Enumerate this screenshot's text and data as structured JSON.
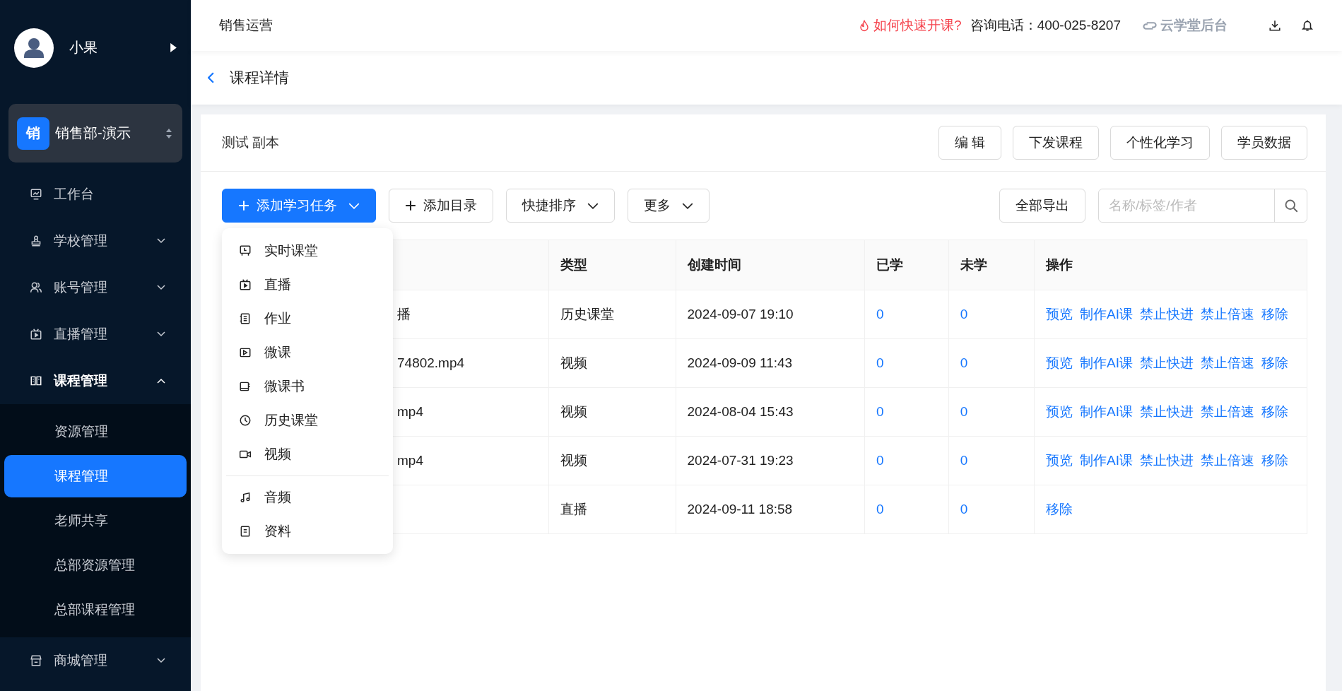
{
  "sidebar": {
    "user": {
      "name": "小果"
    },
    "org": {
      "badge": "销",
      "name": "销售部-演示"
    },
    "items": [
      {
        "label": "工作台",
        "kind": "link"
      },
      {
        "label": "学校管理",
        "kind": "group",
        "expanded": false
      },
      {
        "label": "账号管理",
        "kind": "group",
        "expanded": false
      },
      {
        "label": "直播管理",
        "kind": "group",
        "expanded": false
      },
      {
        "label": "课程管理",
        "kind": "group",
        "expanded": true,
        "children": [
          {
            "label": "资源管理",
            "selected": false
          },
          {
            "label": "课程管理",
            "selected": true
          },
          {
            "label": "老师共享",
            "selected": false
          },
          {
            "label": "总部资源管理",
            "selected": false
          },
          {
            "label": "总部课程管理",
            "selected": false
          }
        ]
      },
      {
        "label": "商城管理",
        "kind": "group",
        "expanded": false
      }
    ]
  },
  "header": {
    "title": "销售运营",
    "help_link": "如何快速开课?",
    "phone": "咨询电话：400-025-8207",
    "brand": "云学堂后台"
  },
  "breadcrumb": {
    "title": "课程详情"
  },
  "course": {
    "title": "测试 副本",
    "actions": [
      "编 辑",
      "下发课程",
      "个性化学习",
      "学员数据"
    ]
  },
  "toolbar": {
    "add_task": "添加学习任务",
    "add_folder": "添加目录",
    "sort": "快捷排序",
    "more": "更多",
    "export": "全部导出",
    "search": {
      "placeholder": "名称/标签/作者"
    }
  },
  "task_menu": {
    "groups": [
      [
        {
          "label": "实时课堂"
        },
        {
          "label": "直播"
        },
        {
          "label": "作业"
        },
        {
          "label": "微课"
        },
        {
          "label": "微课书"
        },
        {
          "label": "历史课堂"
        },
        {
          "label": "视频"
        }
      ],
      [
        {
          "label": "音频"
        },
        {
          "label": "资料"
        }
      ]
    ]
  },
  "table": {
    "columns": [
      "类型",
      "创建时间",
      "已学",
      "未学",
      "操作"
    ],
    "rows": [
      {
        "name": "播",
        "type": "历史课堂",
        "created": "2024-09-07 19:10",
        "learned": "0",
        "unlearned": "0",
        "actions": [
          "预览",
          "制作AI课",
          "禁止快进",
          "禁止倍速",
          "移除"
        ]
      },
      {
        "name": "74802.mp4",
        "type": "视频",
        "created": "2024-09-09 11:43",
        "learned": "0",
        "unlearned": "0",
        "actions": [
          "预览",
          "制作AI课",
          "禁止快进",
          "禁止倍速",
          "移除"
        ]
      },
      {
        "name": "mp4",
        "type": "视频",
        "created": "2024-08-04 15:43",
        "learned": "0",
        "unlearned": "0",
        "actions": [
          "预览",
          "制作AI课",
          "禁止快进",
          "禁止倍速",
          "移除"
        ]
      },
      {
        "name": "mp4",
        "type": "视频",
        "created": "2024-07-31 19:23",
        "learned": "0",
        "unlearned": "0",
        "actions": [
          "预览",
          "制作AI课",
          "禁止快进",
          "禁止倍速",
          "移除"
        ]
      },
      {
        "type": "直播",
        "created": "2024-09-11 18:58",
        "learned": "0",
        "unlearned": "0",
        "actions": [
          "移除"
        ]
      }
    ]
  }
}
